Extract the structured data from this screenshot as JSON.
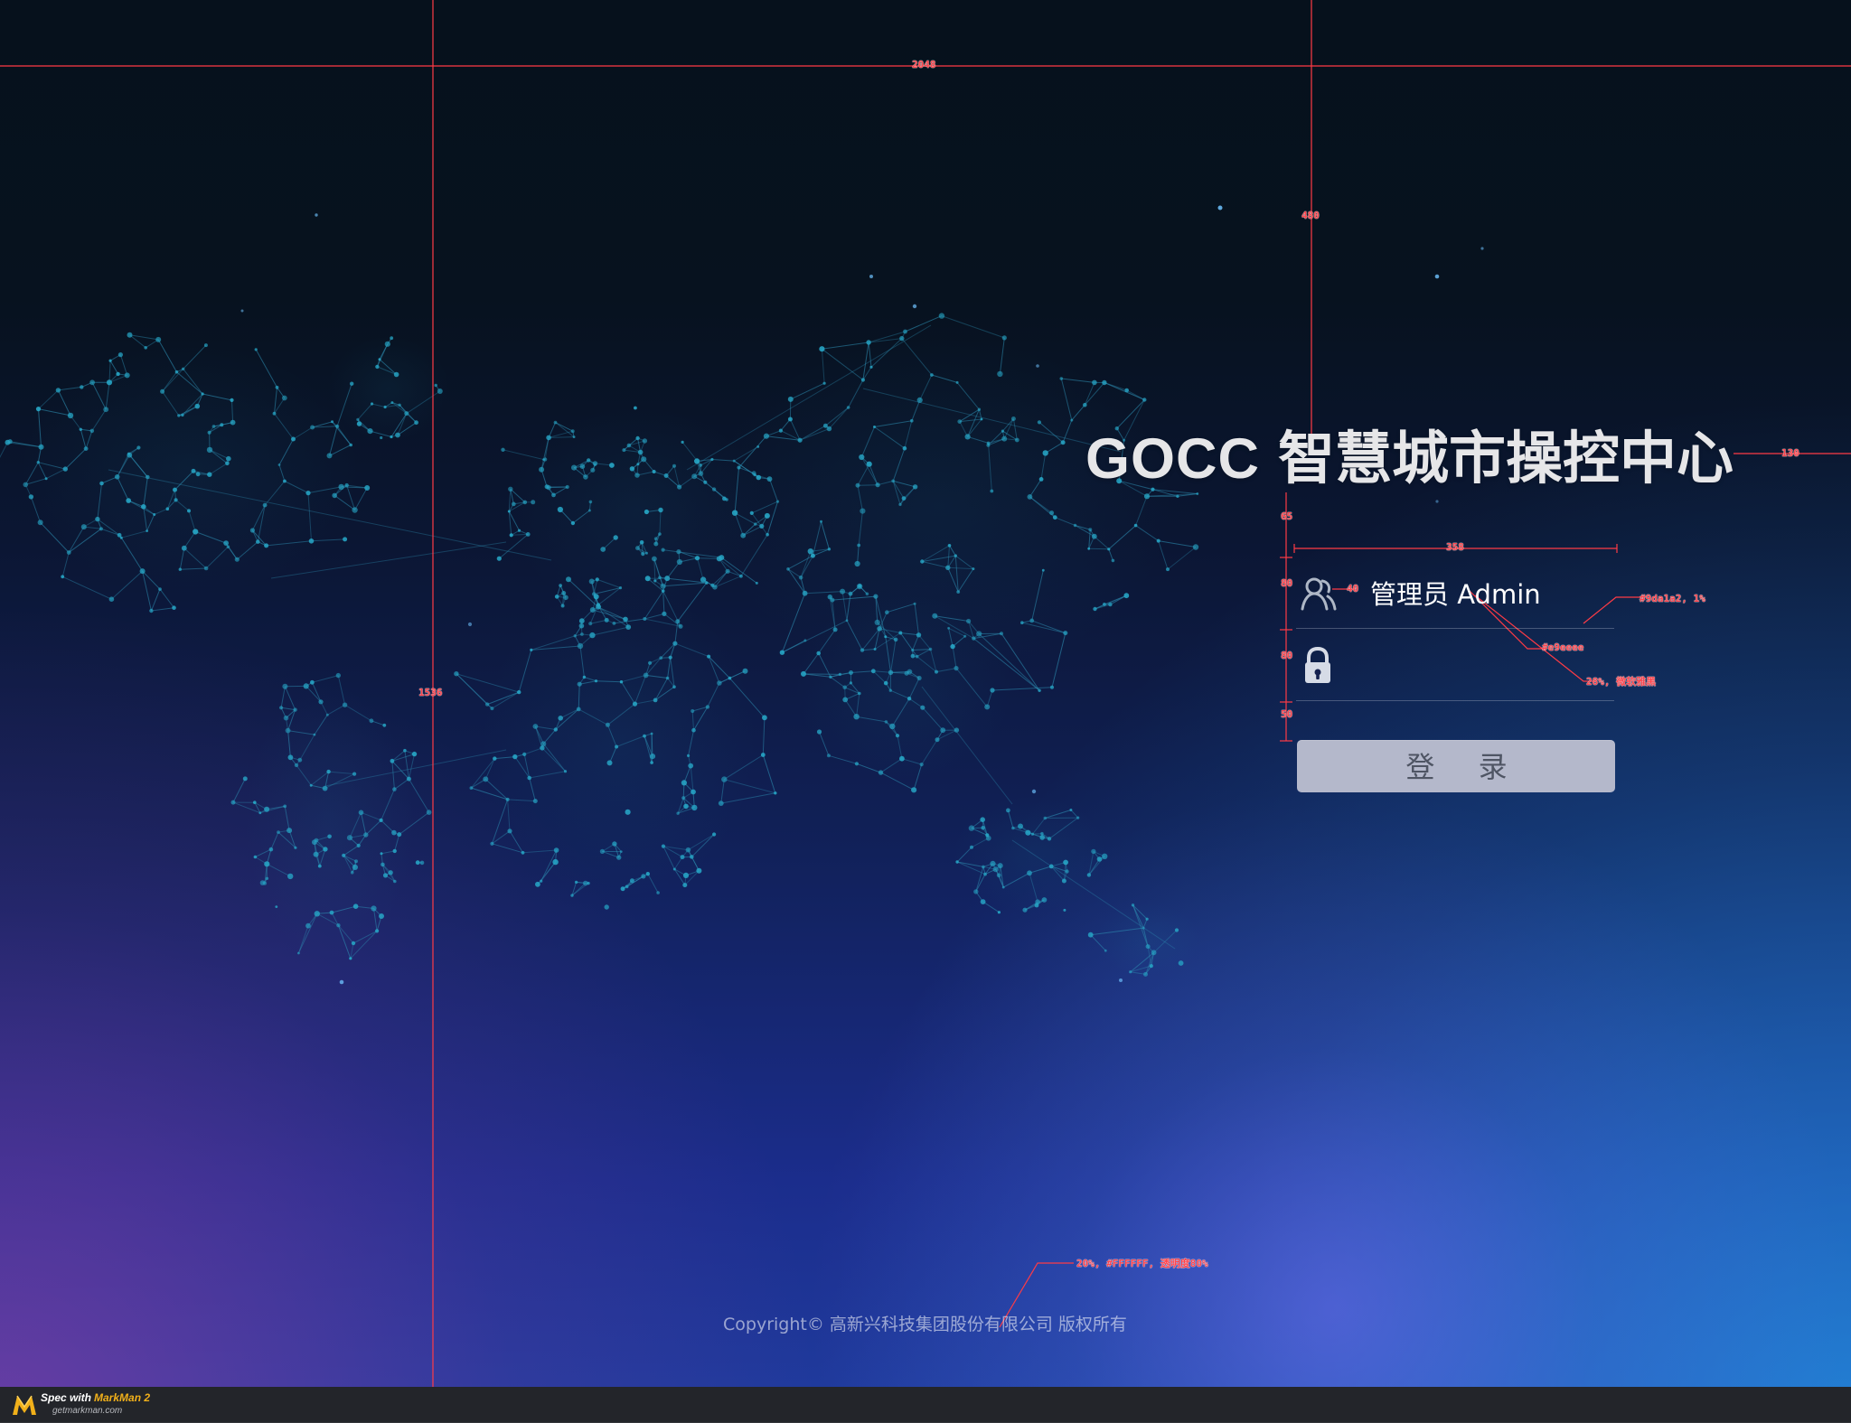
{
  "page": {
    "title_latin": "GOCC",
    "title_chinese": "智慧城市操控中心",
    "username_value": "管理员 Admin",
    "password_value": "",
    "login_button_label": "登 录",
    "copyright": "Copyright©  高新兴科技集团股份有限公司 版权所有"
  },
  "icons": {
    "user": "user-icon",
    "lock": "lock-icon",
    "markman_logo": "markman-logo-icon"
  },
  "markman": {
    "brand_prefix": "Spec with",
    "brand_name": "MarkMan 2",
    "site": "getmarkman.com"
  },
  "spec_annotations": {
    "page_width": "2048",
    "title_top": "480",
    "left_height": "1536",
    "title_right": "130",
    "title_gap": "65",
    "field_width": "358",
    "username_height": "80",
    "password_height": "80",
    "button_gap": "50",
    "icon_gap": "40",
    "underline_style": "#9da1a2, 1%",
    "input_color": "#e9eeee",
    "input_font": "28%, 微软雅黑",
    "copyright_font": "20%, #FFFFFF, 透明度80%"
  },
  "colors": {
    "title": "#e6e6e8",
    "input_text": "#ffffff",
    "button_background": "#b4b8cb",
    "button_text": "#4f5564",
    "annotation_red": "#ff454d",
    "map_line": "#2d8eb2",
    "map_node": "#27a8c8"
  }
}
